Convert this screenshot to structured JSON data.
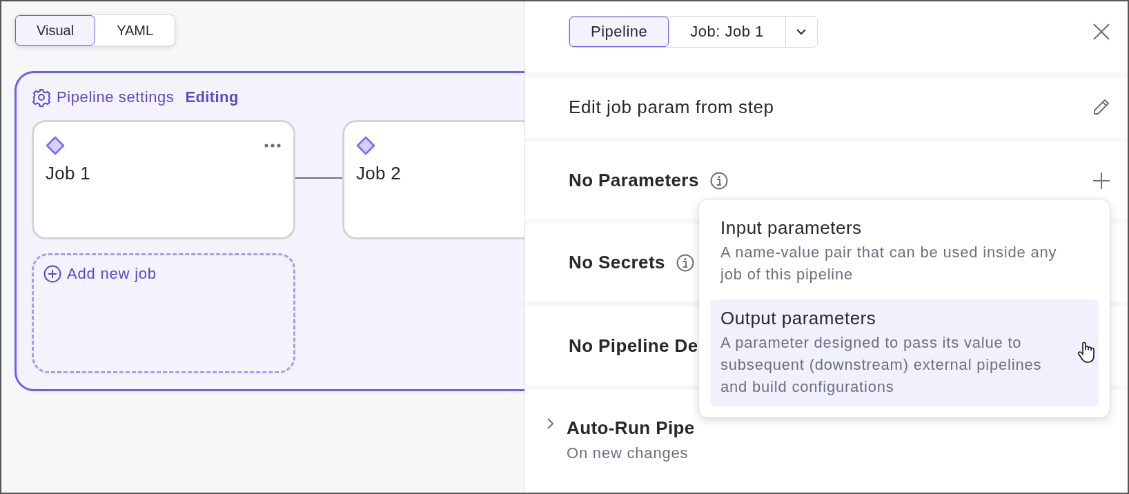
{
  "view_toggle": [
    {
      "label": "Visual",
      "selected": true
    },
    {
      "label": "YAML",
      "selected": false
    }
  ],
  "pipeline": {
    "settings_label": "Pipeline settings",
    "status": "Editing",
    "add_job": "Add new job",
    "jobs": [
      {
        "name": "Job 1",
        "has_menu": true
      },
      {
        "name": "Job 2",
        "has_menu": false
      }
    ]
  },
  "panel": {
    "tabs": [
      {
        "label": "Pipeline",
        "selected": true
      },
      {
        "label": "Job: Job 1",
        "selected": false
      }
    ],
    "sections": [
      {
        "kind": "editable",
        "title": "Edit job param from step",
        "info": false
      },
      {
        "kind": "addable",
        "title": "No Parameters",
        "info": true
      },
      {
        "kind": "heading",
        "title": "No Secrets",
        "info": true
      },
      {
        "kind": "heading",
        "title": "No Pipeline De",
        "info": false
      },
      {
        "kind": "collapsible",
        "title": "Auto-Run Pipe",
        "subtitle": "On new changes",
        "expanded": false
      }
    ]
  },
  "menu": {
    "items": [
      {
        "title": "Input parameters",
        "description": "A name-value pair that can be used inside any job of this pipeline",
        "selected": false
      },
      {
        "title": "Output parameters",
        "description": "A parameter designed to pass its value to subsequent (downstream) external pipelines and build configurations",
        "selected": true
      }
    ]
  }
}
